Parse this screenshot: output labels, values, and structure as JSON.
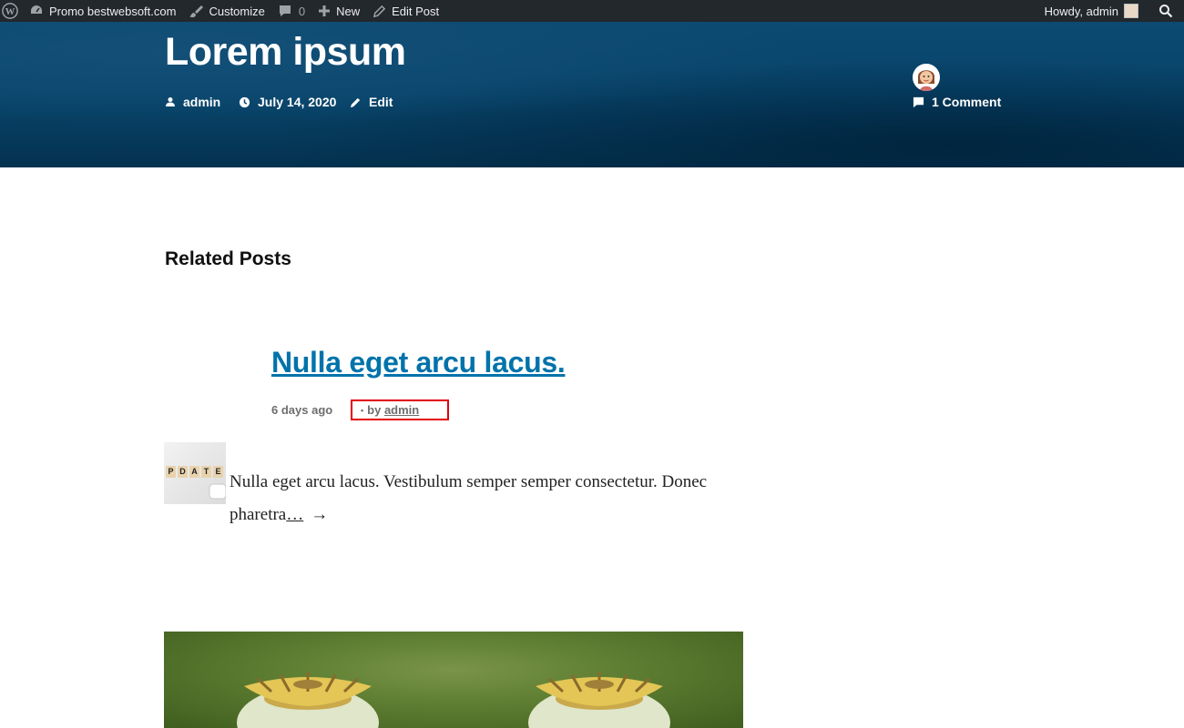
{
  "adminbar": {
    "site_name": "Promo bestwebsoft.com",
    "customize": "Customize",
    "comments_count": "0",
    "new": "New",
    "edit_post": "Edit Post",
    "howdy": "Howdy, admin"
  },
  "post": {
    "title": "Lorem ipsum",
    "author": "admin",
    "date": "July 14, 2020",
    "edit": "Edit",
    "comments": "1 Comment"
  },
  "related": {
    "heading": "Related Posts",
    "title": "Nulla eget arcu lacus.",
    "age": "6 days ago",
    "by": "by",
    "author": "admin",
    "thumbnail_text": [
      "P",
      "D",
      "A",
      "T",
      "E"
    ],
    "excerpt": "Nulla eget arcu lacus. Vestibulum semper semper consectetur. Donec pharetra",
    "more": "…",
    "arrow": "→"
  },
  "colors": {
    "adminbar_bg": "#23282d",
    "hero_bg": "#08446b",
    "link": "#0073aa",
    "highlight_box": "#e3000b"
  }
}
